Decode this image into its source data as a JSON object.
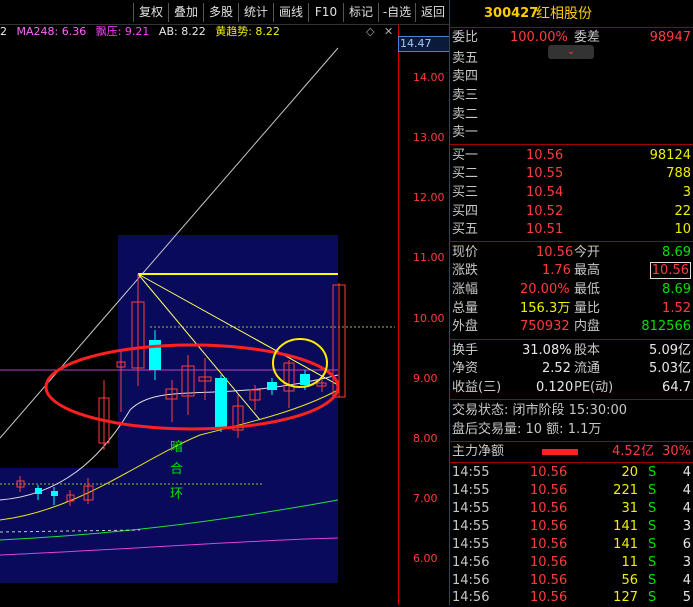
{
  "toolbar": {
    "buttons": [
      "复权",
      "叠加",
      "多股",
      "统计",
      "画线",
      "F10",
      "标记",
      "-自选",
      "返回"
    ]
  },
  "indicator": {
    "prefix": "2",
    "ma248": "MA248: 6.36",
    "piaoya": "飘压: 9.21",
    "ab": "AB: 8.22",
    "huangqushi": "黄趋势: 8.22"
  },
  "chart": {
    "current_price_label": "14.47",
    "ticks": [
      "14.00",
      "13.00",
      "12.00",
      "11.00",
      "10.00",
      "9.00",
      "8.00",
      "7.00",
      "6.00"
    ],
    "annotation": [
      "暗",
      "合",
      "环"
    ],
    "colors": {
      "up": "#ff3c3c",
      "down": "#00ffff",
      "bg_panel": "#0a0a5a",
      "ellipse": "#ff2020",
      "circle": "#ffee00"
    }
  },
  "stock": {
    "code": "300427",
    "name": "红相股份"
  },
  "weibi": {
    "label": "委比",
    "pct": "100.00%",
    "label2": "委差",
    "value": "98947"
  },
  "sells": [
    {
      "label": "卖五",
      "price": "",
      "vol": ""
    },
    {
      "label": "卖四",
      "price": "",
      "vol": ""
    },
    {
      "label": "卖三",
      "price": "",
      "vol": ""
    },
    {
      "label": "卖二",
      "price": "",
      "vol": ""
    },
    {
      "label": "卖一",
      "price": "",
      "vol": ""
    }
  ],
  "buys": [
    {
      "label": "买一",
      "price": "10.56",
      "vol": "98124"
    },
    {
      "label": "买二",
      "price": "10.55",
      "vol": "788"
    },
    {
      "label": "买三",
      "price": "10.54",
      "vol": "3"
    },
    {
      "label": "买四",
      "price": "10.52",
      "vol": "22"
    },
    {
      "label": "买五",
      "price": "10.51",
      "vol": "10"
    }
  ],
  "quote": [
    {
      "l1": "现价",
      "v1": "10.56",
      "c1": "red",
      "l2": "今开",
      "v2": "8.69",
      "c2": "green"
    },
    {
      "l1": "涨跌",
      "v1": "1.76",
      "c1": "red",
      "l2": "最高",
      "v2": "10.56",
      "c2": "red"
    },
    {
      "l1": "涨幅",
      "v1": "20.00%",
      "c1": "red",
      "l2": "最低",
      "v2": "8.69",
      "c2": "green"
    },
    {
      "l1": "总量",
      "v1": "156.3万",
      "c1": "yellow",
      "l2": "量比",
      "v2": "1.52",
      "c2": "red"
    },
    {
      "l1": "外盘",
      "v1": "750932",
      "c1": "red",
      "l2": "内盘",
      "v2": "812566",
      "c2": "green"
    }
  ],
  "stats": [
    {
      "l1": "换手",
      "v1": "31.08%",
      "l2": "股本",
      "v2": "5.09亿"
    },
    {
      "l1": "净资",
      "v1": "2.52",
      "l2": "流通",
      "v2": "5.03亿"
    },
    {
      "l1": "收益(三)",
      "v1": "0.120",
      "l2": "PE(动)",
      "v2": "64.7"
    }
  ],
  "trade_status": "交易状态: 闭市阶段 15:30:00",
  "after_hours": "盘后交易量: 10  额: 1.1万",
  "main_flow": {
    "label": "主力净额",
    "value": "4.52亿",
    "pct": "30%"
  },
  "ticks_list": [
    {
      "time": "14:55",
      "price": "10.56",
      "vol": "20",
      "side": "S",
      "n": "4"
    },
    {
      "time": "14:55",
      "price": "10.56",
      "vol": "221",
      "side": "S",
      "n": "4"
    },
    {
      "time": "14:55",
      "price": "10.56",
      "vol": "31",
      "side": "S",
      "n": "4"
    },
    {
      "time": "14:55",
      "price": "10.56",
      "vol": "141",
      "side": "S",
      "n": "3"
    },
    {
      "time": "14:55",
      "price": "10.56",
      "vol": "141",
      "side": "S",
      "n": "6"
    },
    {
      "time": "14:56",
      "price": "10.56",
      "vol": "11",
      "side": "S",
      "n": "3"
    },
    {
      "time": "14:56",
      "price": "10.56",
      "vol": "56",
      "side": "S",
      "n": "4"
    },
    {
      "time": "14:56",
      "price": "10.56",
      "vol": "127",
      "side": "S",
      "n": "5"
    }
  ]
}
